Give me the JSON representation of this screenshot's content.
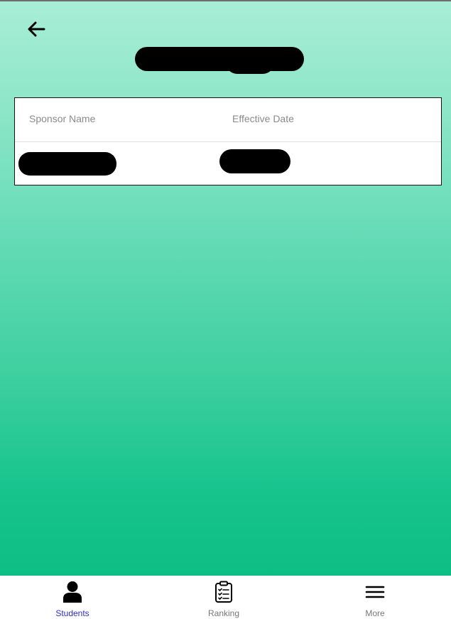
{
  "header": {
    "back_icon": "arrow-left-icon",
    "title": "[redacted]"
  },
  "table": {
    "columns": [
      "Sponsor Name",
      "Effective Date"
    ],
    "rows": [
      {
        "sponsor_name": "[redacted]",
        "effective_date": "[redacted]"
      }
    ]
  },
  "bottom_nav": {
    "items": [
      {
        "label": "Students",
        "icon": "person-icon",
        "active": true
      },
      {
        "label": "Ranking",
        "icon": "clipboard-list-icon",
        "active": false
      },
      {
        "label": "More",
        "icon": "menu-icon",
        "active": false
      }
    ],
    "active_color": "#2a2ad0",
    "inactive_color": "#777777"
  },
  "colors": {
    "gradient_top": "#a8eed6",
    "gradient_bottom": "#0dbe84"
  }
}
